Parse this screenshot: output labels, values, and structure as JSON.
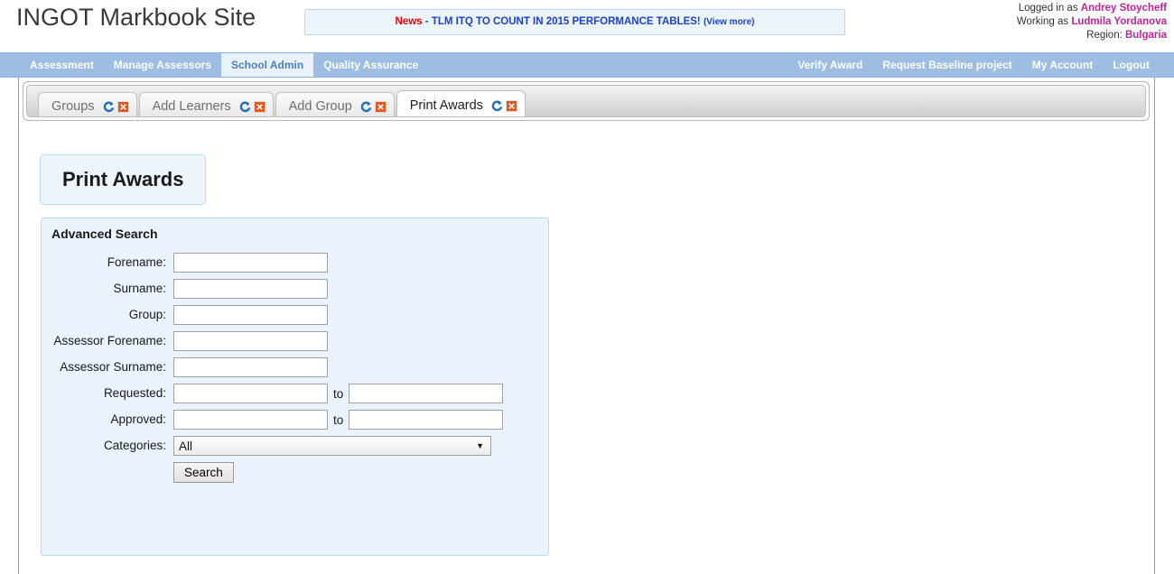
{
  "header": {
    "site_title": "INGOT Markbook Site",
    "news": {
      "label": "News",
      "separator": " - ",
      "text": "TLM ITQ TO COUNT IN 2015 PERFORMANCE TABLES!",
      "view_more": "(View more)"
    },
    "user": {
      "logged_in_prefix": "Logged in as ",
      "logged_in_name": "Andrey Stoycheff",
      "working_as_prefix": "Working as ",
      "working_as_name": "Ludmila Yordanova",
      "region_prefix": "Region: ",
      "region_name": "Bulgaria"
    }
  },
  "nav": {
    "left": [
      {
        "label": "Assessment",
        "active": false
      },
      {
        "label": "Manage Assessors",
        "active": false
      },
      {
        "label": "School Admin",
        "active": true
      },
      {
        "label": "Quality Assurance",
        "active": false
      }
    ],
    "right": [
      {
        "label": "Verify Award"
      },
      {
        "label": "Request Baseline project"
      },
      {
        "label": "My Account"
      },
      {
        "label": "Logout"
      }
    ]
  },
  "tabs": [
    {
      "label": "Groups",
      "active": false
    },
    {
      "label": "Add Learners",
      "active": false
    },
    {
      "label": "Add Group",
      "active": false
    },
    {
      "label": "Print Awards",
      "active": true
    }
  ],
  "tab_icons": {
    "refresh": "refresh-icon",
    "close": "close-icon"
  },
  "page": {
    "title": "Print Awards"
  },
  "search": {
    "panel_title": "Advanced Search",
    "fields": [
      {
        "label": "Forename:",
        "value": "",
        "placeholder": "",
        "type": "text"
      },
      {
        "label": "Surname:",
        "value": "",
        "placeholder": "",
        "type": "text"
      },
      {
        "label": "Group:",
        "value": "",
        "placeholder": "",
        "type": "text"
      },
      {
        "label": "Assessor Forename:",
        "value": "",
        "placeholder": "",
        "type": "text"
      },
      {
        "label": "Assessor Surname:",
        "value": "",
        "placeholder": "",
        "type": "text"
      }
    ],
    "ranges": [
      {
        "label": "Requested:",
        "from": "",
        "to_label": "to",
        "to": ""
      },
      {
        "label": "Approved:",
        "from": "",
        "to_label": "to",
        "to": ""
      }
    ],
    "categories": {
      "label": "Categories:",
      "selected": "All",
      "caret": "▼"
    },
    "search_button": "Search"
  },
  "colors": {
    "nav_bar": "#9dbde2",
    "nav_active_bg": "#e9f2fb",
    "nav_active_text": "#4a7fc1",
    "panel_bg": "#eaf2fb",
    "panel_border": "#b9dcee",
    "news_label": "#ee0000",
    "news_text": "#1b42c8",
    "user_name": "#c0249c"
  }
}
